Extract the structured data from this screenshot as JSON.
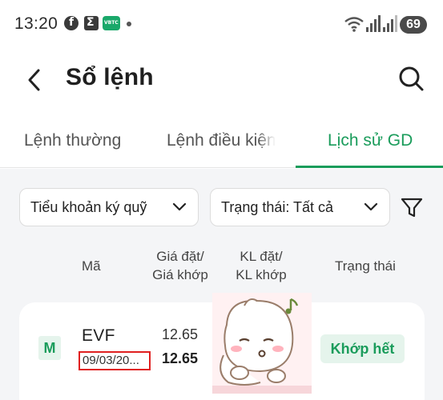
{
  "status_bar": {
    "time": "13:20",
    "app_icons": [
      "facebook-icon",
      "sigma-icon",
      "vbtc-icon"
    ],
    "vbtc_label": "VBTC",
    "battery": "69"
  },
  "header": {
    "title": "Sổ lệnh"
  },
  "tabs": [
    {
      "label": "Lệnh thường",
      "active": false
    },
    {
      "label": "Lệnh điều kiện",
      "active": false
    },
    {
      "label": "Lịch sử GD",
      "active": true
    }
  ],
  "filters": {
    "account": "Tiểu khoản ký quỹ",
    "status": "Trạng thái: Tất cả"
  },
  "columns": {
    "symbol": "Mã",
    "price_line1": "Giá đặt/",
    "price_line2": "Giá khớp",
    "qty_line1": "KL đặt/",
    "qty_line2": "KL khớp",
    "status": "Trạng thái"
  },
  "orders": [
    {
      "type": "M",
      "symbol": "EVF",
      "date": "09/03/20...",
      "order_price": "12.65",
      "match_price": "12.65",
      "status": "Khớp hết"
    }
  ],
  "colors": {
    "accent": "#1a9c5b",
    "accent_light": "#e5f4ec",
    "highlight_box": "#e02020",
    "background": "#f4f5f7"
  }
}
